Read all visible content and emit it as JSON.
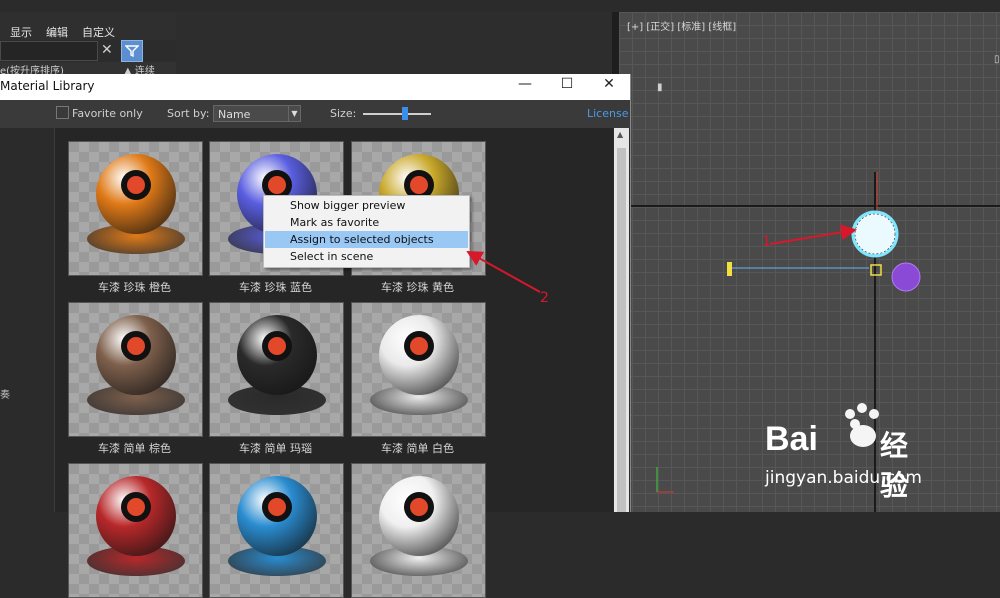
{
  "bg_app": {
    "menu": [
      "显示",
      "编辑",
      "自定义"
    ],
    "sort_row": "e(按升序排序)",
    "sort_row_right": "▲ 连续"
  },
  "viewport": {
    "label": "[+] [正交] [标准] [线框]"
  },
  "window": {
    "title": "Material Library",
    "controls": {
      "minimize": "—",
      "maximize": "☐",
      "close": "✕"
    },
    "favorite_label": "Favorite only",
    "sort_label": "Sort by:",
    "sort_value": "Name",
    "size_label": "Size:",
    "size_fraction": 0.6,
    "license_label": "License",
    "left_pane_char": "奏",
    "materials": [
      {
        "name": "车漆 珍珠 橙色",
        "color": "#e07a18"
      },
      {
        "name": "车漆 珍珠 蓝色",
        "color": "#5a5ee0"
      },
      {
        "name": "车漆 珍珠 黄色",
        "color": "#c9a82a"
      },
      {
        "name": "车漆 简单 棕色",
        "color": "#7e604c"
      },
      {
        "name": "车漆 简单 玛瑙",
        "color": "#2a2a2a"
      },
      {
        "name": "车漆 简单 白色",
        "color": "#eaeaea"
      },
      {
        "name": "",
        "color": "#b8282a"
      },
      {
        "name": "",
        "color": "#2a8cd0"
      },
      {
        "name": "",
        "color": "#f0f0f0"
      }
    ]
  },
  "context_menu": {
    "items": [
      "Show bigger preview",
      "Mark as favorite",
      "Assign to selected objects",
      "Select in scene"
    ],
    "highlighted_index": 2
  },
  "annotations": {
    "label1": "1",
    "label2": "2",
    "arrow_color": "#d8182a"
  },
  "watermark": {
    "brand": "Bai",
    "brand_suffix": "经验",
    "url": "jingyan.baidu.com"
  }
}
